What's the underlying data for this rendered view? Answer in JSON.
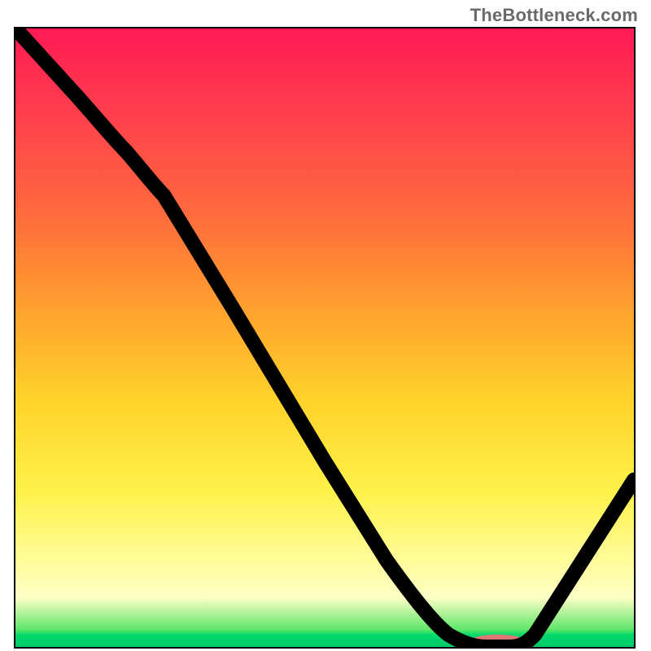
{
  "watermark": "TheBottleneck.com",
  "colors": {
    "gradient_top": "#ff1a54",
    "gradient_mid_orange": "#ffa02e",
    "gradient_mid_yellow": "#fff24a",
    "gradient_bottom_green": "#00c96c",
    "curve_stroke": "#000000",
    "marker_fill": "#e07878",
    "border": "#000000"
  },
  "chart_data": {
    "type": "line",
    "title": "",
    "xlabel": "",
    "ylabel": "",
    "xlim": [
      0,
      100
    ],
    "ylim": [
      0,
      100
    ],
    "grid": false,
    "legend": false,
    "series": [
      {
        "name": "bottleneck-curve",
        "x": [
          0,
          10,
          18,
          24,
          35,
          50,
          60,
          70,
          76,
          80,
          84,
          100
        ],
        "values": [
          100,
          89,
          80,
          73,
          55,
          30,
          14,
          2,
          0,
          0,
          2,
          27
        ],
        "note": "values are percent of chart height from bottom; x is percent of chart width from left; approximated visually"
      }
    ],
    "marker": {
      "name": "optimal-range-marker",
      "x_start": 74,
      "x_end": 82,
      "y": 0.5,
      "height": 1.5
    },
    "background": {
      "type": "vertical-gradient",
      "top_color": "#ff1a54",
      "bottom_color": "#00c96c"
    }
  }
}
